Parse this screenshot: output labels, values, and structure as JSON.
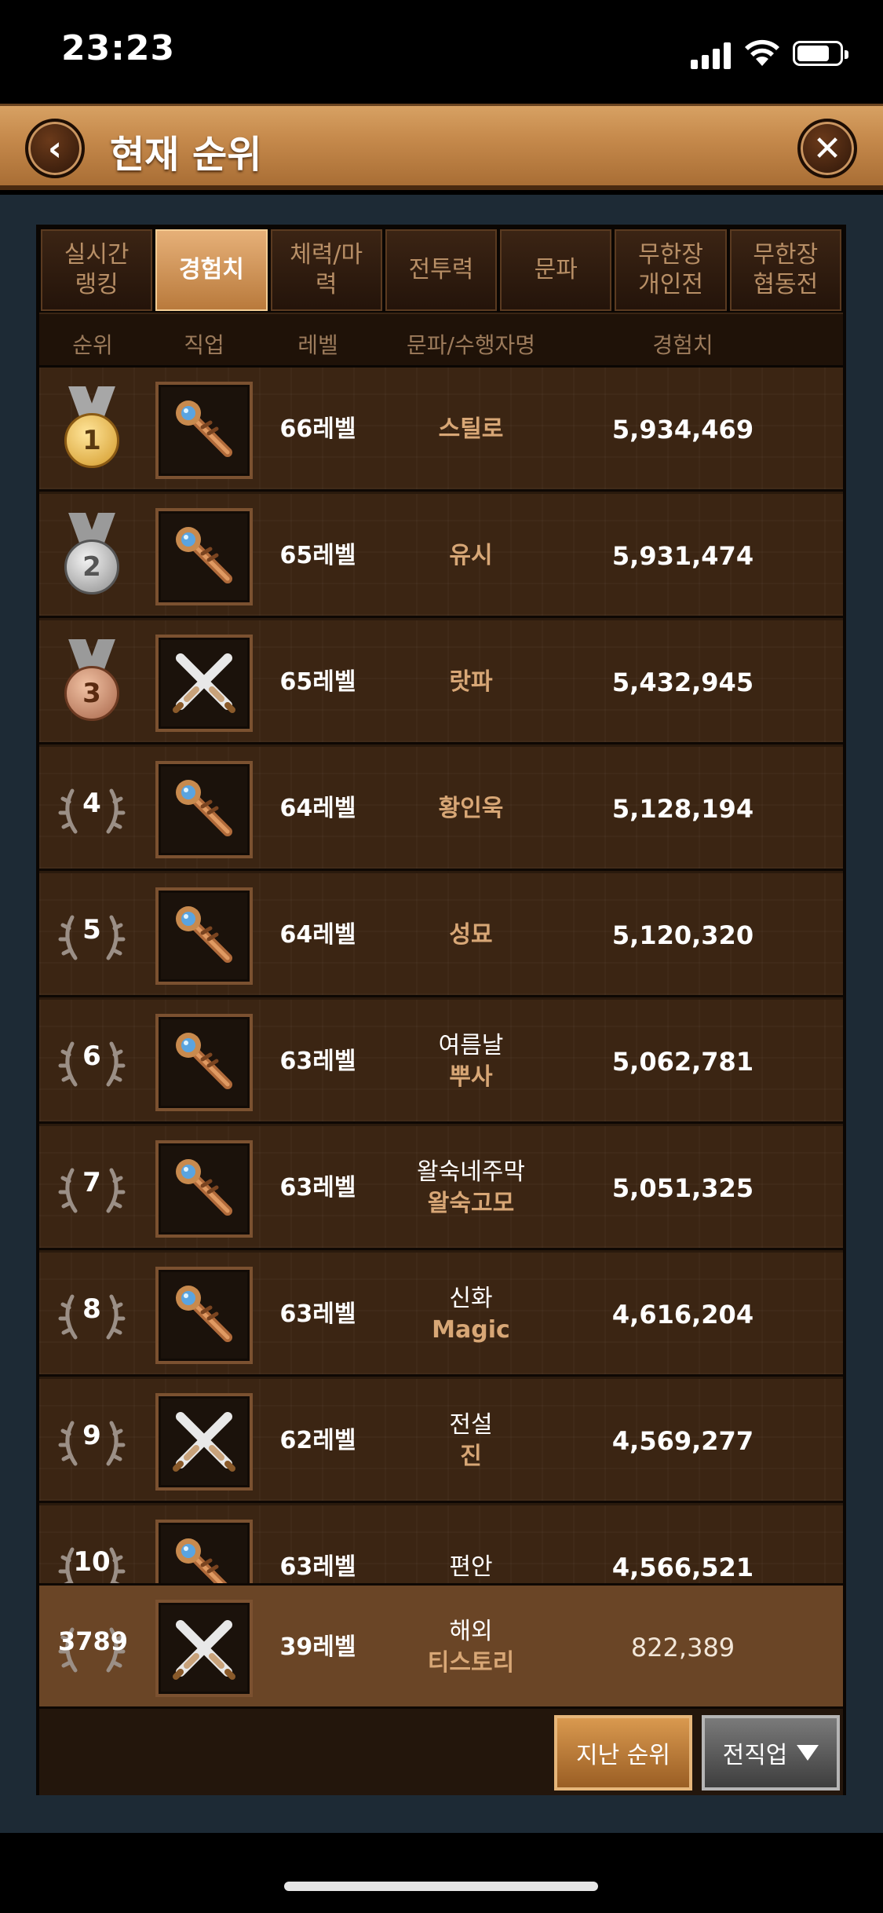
{
  "status_bar": {
    "time": "23:23"
  },
  "header": {
    "title": "현재 순위"
  },
  "tabs": [
    {
      "label": "실시간\n랭킹",
      "active": false
    },
    {
      "label": "경험치",
      "active": true
    },
    {
      "label": "체력/마\n력",
      "active": false
    },
    {
      "label": "전투력",
      "active": false
    },
    {
      "label": "문파",
      "active": false
    },
    {
      "label": "무한장\n개인전",
      "active": false
    },
    {
      "label": "무한장\n협동전",
      "active": false
    }
  ],
  "columns": {
    "rank": "순위",
    "job": "직업",
    "level": "레벨",
    "name": "문파/수행자명",
    "exp": "경험치"
  },
  "rows": [
    {
      "rank": "1",
      "job_icon": "staff-icon",
      "level": "66레벨",
      "guild": "",
      "player": "스틸로",
      "exp": "5,934,469"
    },
    {
      "rank": "2",
      "job_icon": "staff-icon",
      "level": "65레벨",
      "guild": "",
      "player": "유시",
      "exp": "5,931,474"
    },
    {
      "rank": "3",
      "job_icon": "crossed-blades-icon",
      "level": "65레벨",
      "guild": "",
      "player": "랏파",
      "exp": "5,432,945"
    },
    {
      "rank": "4",
      "job_icon": "staff-icon",
      "level": "64레벨",
      "guild": "",
      "player": "황인욱",
      "exp": "5,128,194"
    },
    {
      "rank": "5",
      "job_icon": "staff-icon",
      "level": "64레벨",
      "guild": "",
      "player": "성묘",
      "exp": "5,120,320"
    },
    {
      "rank": "6",
      "job_icon": "staff-icon",
      "level": "63레벨",
      "guild": "여름날",
      "player": "뿌사",
      "exp": "5,062,781"
    },
    {
      "rank": "7",
      "job_icon": "staff-icon",
      "level": "63레벨",
      "guild": "왈숙네주막",
      "player": "왈숙고모",
      "exp": "5,051,325"
    },
    {
      "rank": "8",
      "job_icon": "staff-icon",
      "level": "63레벨",
      "guild": "신화",
      "player": "Magic",
      "exp": "4,616,204"
    },
    {
      "rank": "9",
      "job_icon": "crossed-blades-icon",
      "level": "62레벨",
      "guild": "전설",
      "player": "진",
      "exp": "4,569,277"
    },
    {
      "rank": "10",
      "job_icon": "staff-icon",
      "level": "63레벨",
      "guild": "편안",
      "player": "",
      "exp": "4,566,521"
    }
  ],
  "my_rank": {
    "rank": "3789",
    "job_icon": "crossed-blades-icon",
    "level": "39레벨",
    "guild": "해외",
    "player": "티스토리",
    "exp": "822,389"
  },
  "footer": {
    "past_rank_label": "지난 순위",
    "job_filter_label": "전직업"
  }
}
